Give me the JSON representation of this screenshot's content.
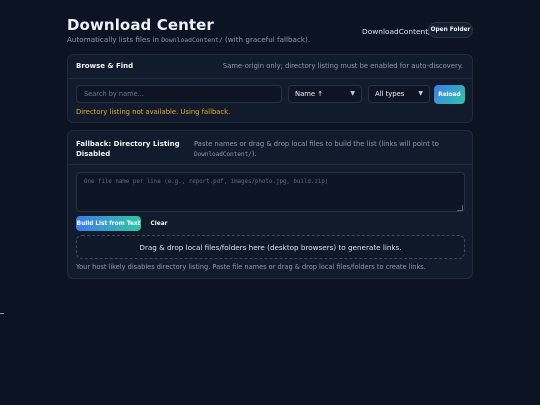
{
  "header": {
    "title": "Download Center",
    "subtitle_prefix": "Automatically lists files in ",
    "subtitle_code": "DownloadContent/",
    "subtitle_suffix": " (with graceful fallback).",
    "folder_path": "DownloadContent/",
    "open_folder_label": "Open Folder"
  },
  "browse": {
    "title": "Browse & Find",
    "note": "Same-origin only; directory listing must be enabled for auto-discovery.",
    "search_placeholder": "Search by name...",
    "search_value": "",
    "sort_selected": "Name ↑",
    "type_selected": "All types",
    "reload_label": "Reload",
    "status_message": "Directory listing not available. Using fallback."
  },
  "fallback": {
    "title": "Fallback: Directory Listing Disabled",
    "note_prefix": "Paste names or drag & drop local files to build the list (links will point to ",
    "note_code": "DownloadContent/",
    "note_suffix": ").",
    "textarea_placeholder": "One file name per line (e.g., report.pdf, images/photo.jpg, build.zip)",
    "textarea_value": "",
    "build_label": "Build List from Text",
    "clear_label": "Clear",
    "drop_zone_text": "Drag & drop local files/folders here (desktop browsers) to generate links.",
    "help_text": "Your host likely disables directory listing. Paste file names or drag & drop local files/folders to create links."
  },
  "icons": {
    "caret": "chevron-down-icon"
  },
  "colors": {
    "background": "#0c1322",
    "panel": "#121b2b",
    "accent_start": "#3d7bf0",
    "accent_end": "#2fc7a2",
    "warning": "#e8a93b"
  }
}
